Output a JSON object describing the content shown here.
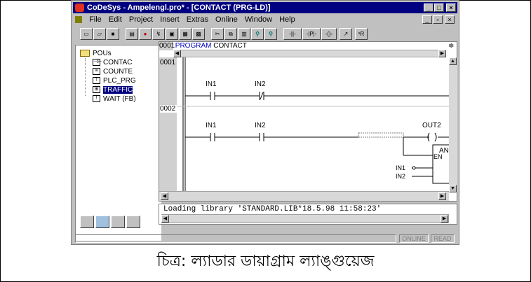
{
  "window": {
    "title": "CoDeSys - Ampelengl.pro* - [CONTACT (PRG-LD)]",
    "caption_buttons": [
      "_",
      "□",
      "×"
    ],
    "mdi_buttons": [
      "_",
      "▫",
      "×"
    ]
  },
  "menu": [
    "File",
    "Edit",
    "Project",
    "Insert",
    "Extras",
    "Online",
    "Window",
    "Help"
  ],
  "toolbar": {
    "buttons": [
      "new-icon",
      "open-icon",
      "save-icon",
      "compile-icon",
      "stop-icon",
      "login-icon",
      "logout-icon",
      "run-icon",
      "step-icon",
      "cut-icon",
      "copy-icon",
      "paste-icon",
      "find-icon",
      "replace-icon",
      "contact-icon",
      "parallel-contact-icon",
      "coil-icon",
      "jump-icon",
      "comment-icon"
    ],
    "labels": [
      "",
      "",
      "",
      "",
      "",
      "",
      "",
      "",
      "",
      "",
      "",
      "",
      "",
      "",
      "-||-",
      "-|P|-",
      "-()-",
      "↗",
      "ˢR"
    ]
  },
  "pou_panel": {
    "root": "POUs",
    "items": [
      {
        "label": "CONTAC",
        "icon": "ld-icon",
        "selected": false
      },
      {
        "label": "COUNTE",
        "icon": "st-icon",
        "selected": false
      },
      {
        "label": "PLC_PRG",
        "icon": "sfc-icon",
        "selected": false
      },
      {
        "label": "TRAFFIC",
        "icon": "fbd-icon",
        "selected": true
      },
      {
        "label": "WAIT (FB)",
        "icon": "il-icon",
        "selected": false
      }
    ]
  },
  "editor": {
    "decl_num": "0001",
    "decl_keyword": "PROGRAM",
    "decl_name": "CONTACT",
    "rungs": [
      {
        "number": "0001",
        "contacts": [
          "IN1",
          "IN2"
        ]
      },
      {
        "number": "0002",
        "contacts": [
          "IN1",
          "IN2"
        ],
        "coil": "OUT2",
        "box": "AND",
        "box_en": "EN",
        "box_inputs": [
          "IN1",
          "IN2"
        ]
      }
    ],
    "negated_contact": "IN2"
  },
  "messages": {
    "text": "Loading library 'STANDARD.LIB*18.5.98 11:58:23'"
  },
  "status": {
    "online": "ONLINE",
    "read": "READ"
  },
  "caption": "চিত্র: ল্যাডার ডায়াগ্রাম ল্যাঙ্গুয়েজ"
}
